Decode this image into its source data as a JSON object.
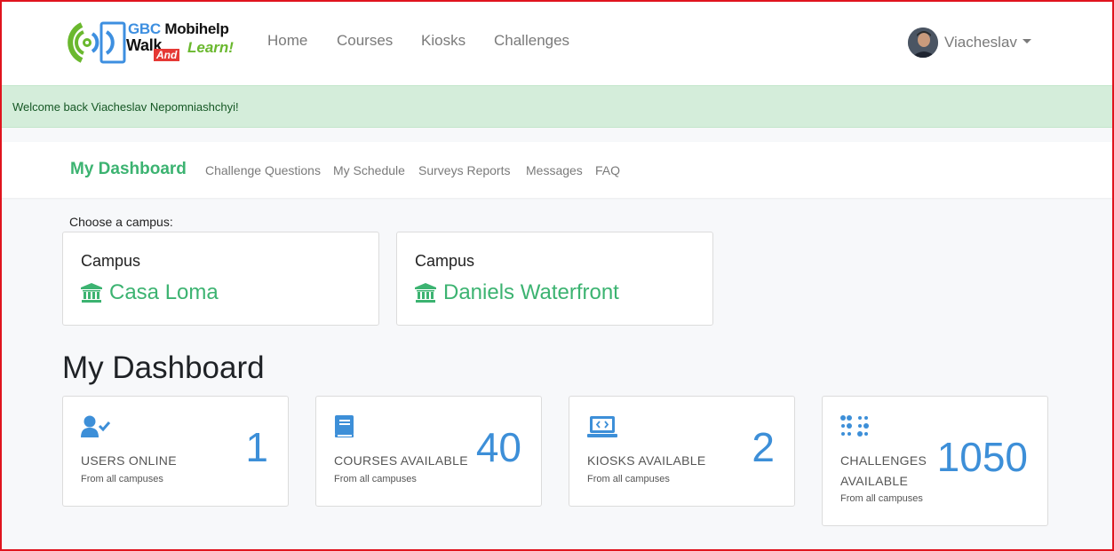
{
  "brand": {
    "line1_prefix": "GBC",
    "line1_rest": "Mobihelp",
    "walk": "Walk",
    "and": "And",
    "learn": "Learn!"
  },
  "topnav": {
    "links": [
      "Home",
      "Courses",
      "Kiosks",
      "Challenges"
    ],
    "user_name": "Viacheslav"
  },
  "alert": {
    "message": "Welcome back Viacheslav Nepomniashchyi!"
  },
  "subnav": {
    "active": "My Dashboard",
    "links": [
      "Challenge Questions",
      "My Schedule",
      "Surveys Reports",
      "Messages",
      "FAQ"
    ]
  },
  "campus": {
    "choose_label": "Choose a campus:",
    "cards": [
      {
        "title": "Campus",
        "name": "Casa Loma",
        "icon": "institution-icon"
      },
      {
        "title": "Campus",
        "name": "Daniels Waterfront",
        "icon": "institution-icon"
      }
    ]
  },
  "dashboard": {
    "title": "My Dashboard",
    "stats": [
      {
        "icon": "user-check-icon",
        "label": "USERS ONLINE",
        "value": "1",
        "sub": "From all campuses"
      },
      {
        "icon": "book-icon",
        "label": "COURSES AVAILABLE",
        "value": "40",
        "sub": "From all campuses"
      },
      {
        "icon": "laptop-code-icon",
        "label": "KIOSKS AVAILABLE",
        "value": "2",
        "sub": "From all campuses"
      },
      {
        "icon": "braille-icon",
        "label_line1": "CHALLENGES",
        "label_line2": "AVAILABLE",
        "value": "1050",
        "sub": "From all campuses"
      }
    ]
  },
  "colors": {
    "accent_green": "#3cb371",
    "stat_blue": "#3d8fd8",
    "alert_bg": "#d4edda",
    "frame_red": "#e0141e"
  }
}
